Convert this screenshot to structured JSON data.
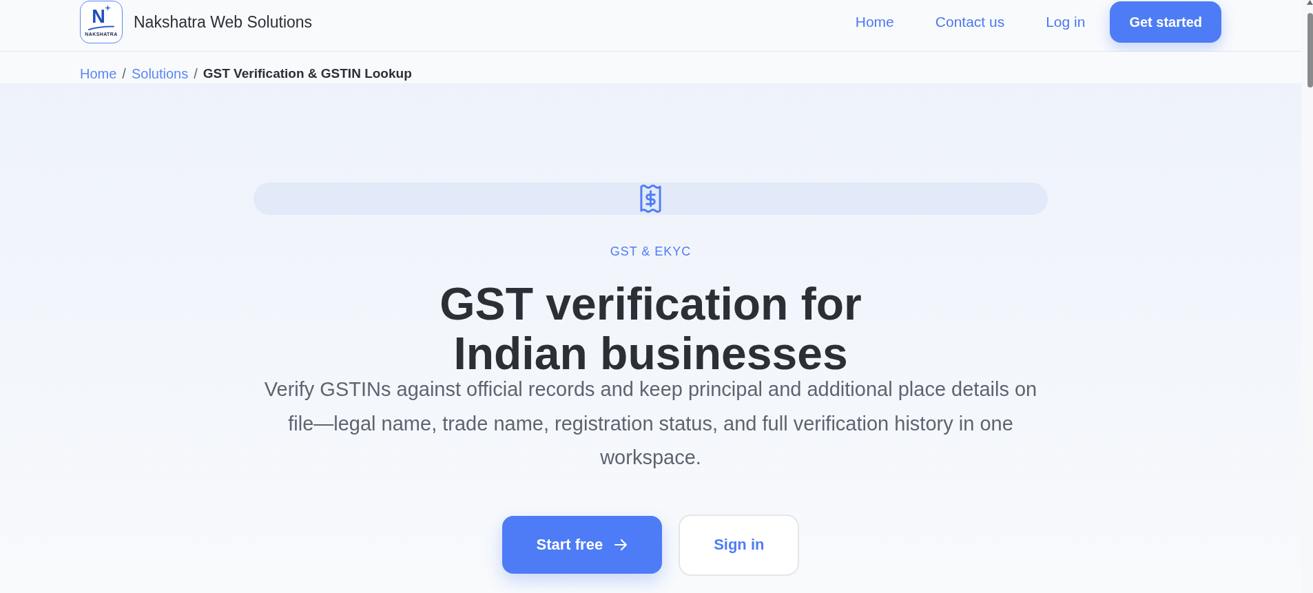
{
  "header": {
    "logo": {
      "letter": "N",
      "wordmark": "NAKSHATRA"
    },
    "brand": "Nakshatra Web Solutions",
    "nav": [
      {
        "label": "Home"
      },
      {
        "label": "Contact us"
      },
      {
        "label": "Log in"
      }
    ],
    "cta": "Get started"
  },
  "breadcrumb": [
    {
      "kind": "link",
      "label": "Home"
    },
    {
      "kind": "separator",
      "label": "/"
    },
    {
      "kind": "link",
      "label": "Solutions"
    },
    {
      "kind": "separator",
      "label": "/"
    },
    {
      "kind": "current",
      "label": "GST Verification & GSTIN Lookup"
    }
  ],
  "hero": {
    "eyebrow": "GST & EKYC",
    "title": "GST verification for Indian businesses",
    "description": "Verify GSTINs against official records and keep principal and additional place details on file—legal name, trade name, registration status, and full verification history in one workspace.",
    "actions": [
      {
        "kind": "primary",
        "label": "Start free"
      },
      {
        "kind": "secondary",
        "label": "Sign in"
      }
    ]
  }
}
